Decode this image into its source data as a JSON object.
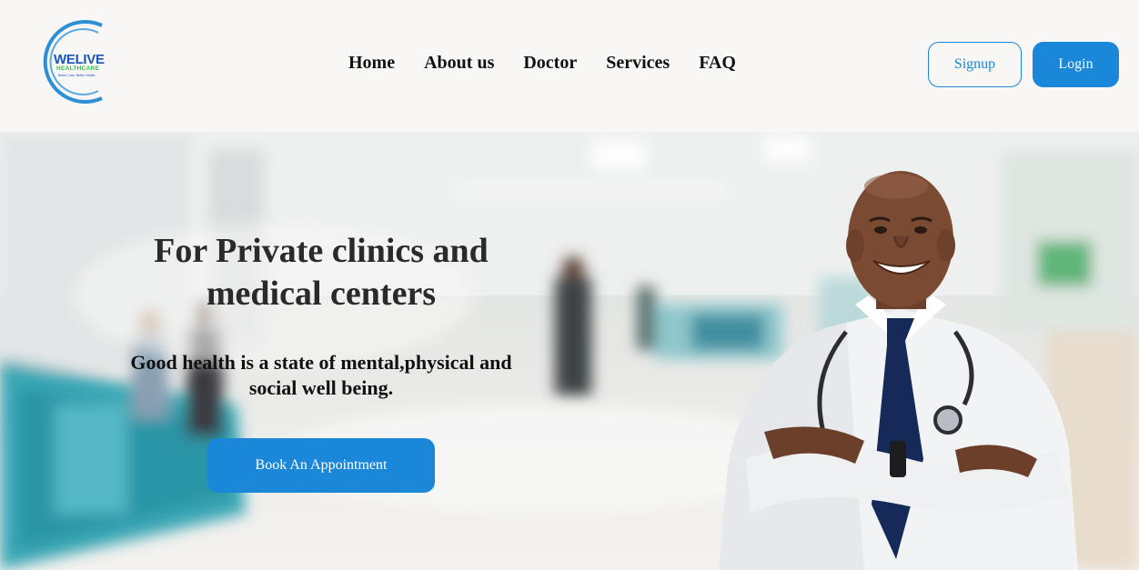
{
  "brand": {
    "name": "WELIVE",
    "sub": "HEALTHCARE",
    "tagline": "Better Care, Better Health..."
  },
  "nav": {
    "items": [
      "Home",
      "About us",
      "Doctor",
      "Services",
      "FAQ"
    ]
  },
  "auth": {
    "signup_label": "Signup",
    "login_label": "Login"
  },
  "hero": {
    "title_line1": "For Private clinics and",
    "title_line2": "medical centers",
    "subtitle_line1": "Good health is a state of mental,physical and",
    "subtitle_line2": "social well being.",
    "cta_label": "Book An Appointment"
  },
  "colors": {
    "accent": "#1b87d8",
    "header_bg": "#f8f7f5",
    "logo_blue": "#1a56b8",
    "logo_green": "#36c04a"
  }
}
